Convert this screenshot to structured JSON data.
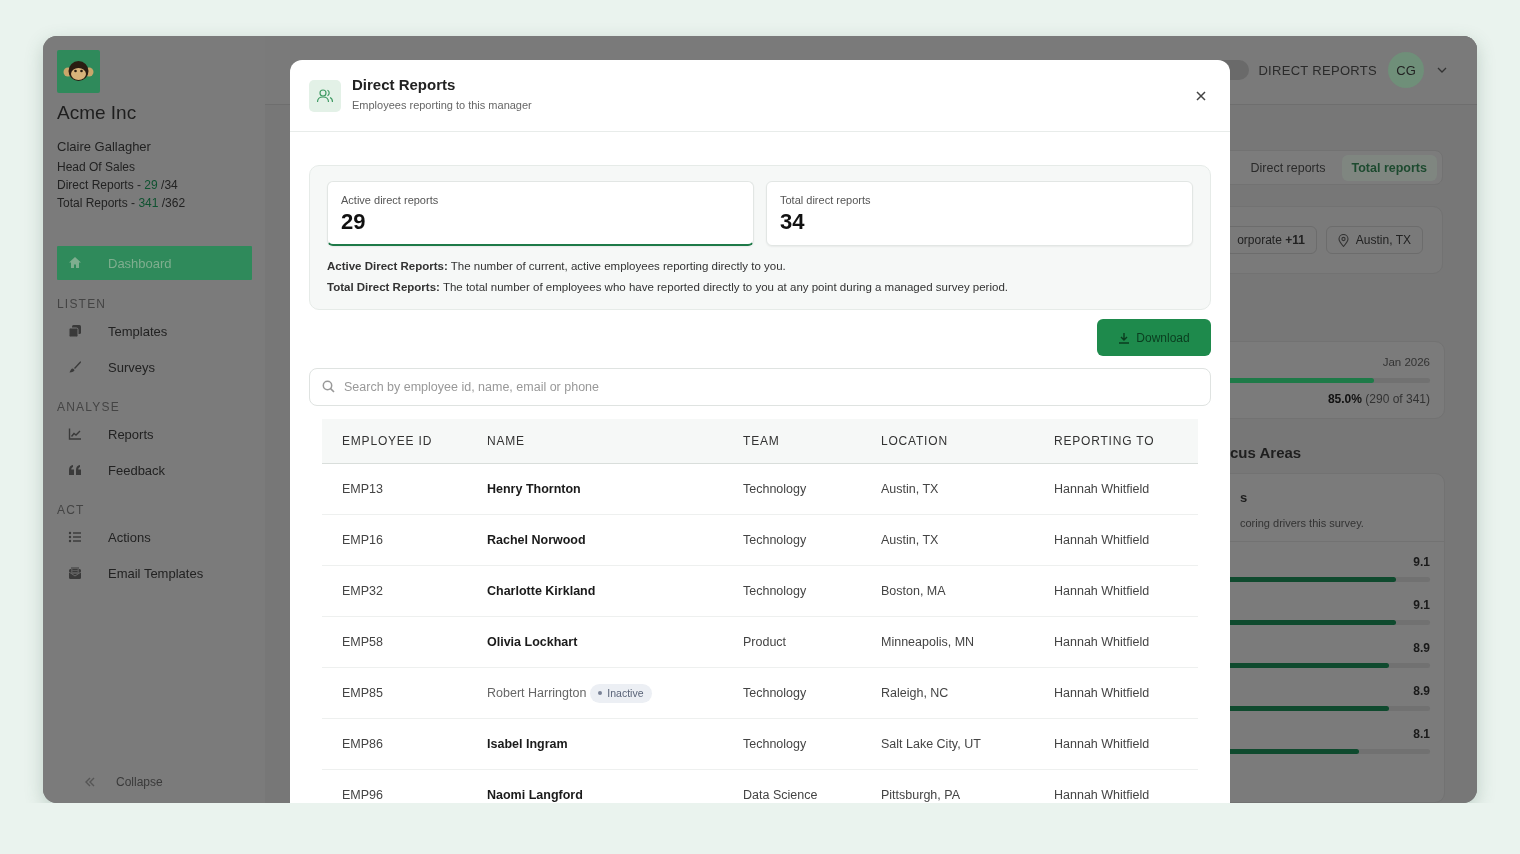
{
  "sidebar": {
    "company": "Acme Inc",
    "user": {
      "name": "Claire Gallagher",
      "role": "Head Of Sales"
    },
    "counts": [
      {
        "label": "Direct Reports -",
        "active": "29",
        "total": "/34"
      },
      {
        "label": "Total Reports -",
        "active": "341",
        "total": "/362"
      }
    ],
    "groups": [
      {
        "items": [
          {
            "label": "Dashboard",
            "selected": true
          }
        ]
      },
      {
        "heading": "LISTEN",
        "items": [
          {
            "label": "Templates",
            "selected": false
          },
          {
            "label": "Surveys",
            "selected": false
          }
        ]
      },
      {
        "heading": "ANALYSE",
        "items": [
          {
            "label": "Reports",
            "selected": false
          },
          {
            "label": "Feedback",
            "selected": false
          }
        ]
      },
      {
        "heading": "ACT",
        "items": [
          {
            "label": "Actions",
            "selected": false
          },
          {
            "label": "Email Templates",
            "selected": false
          }
        ]
      }
    ],
    "collapse": "Collapse"
  },
  "main": {
    "view_toggle_on": false,
    "view_label": "DIRECT REPORTS",
    "avatar": "CG",
    "tabs": [
      {
        "label": "Direct reports",
        "selected": false
      },
      {
        "label": "Total reports",
        "selected": true
      }
    ],
    "filters": [
      "orporate **+11**",
      "Austin, TX"
    ],
    "participation": {
      "period": "Jan 2026",
      "level": 0.85,
      "percent": "85.0%",
      "count": "(290 of 341)"
    },
    "focus_heading": "cus Areas",
    "focus_card": {
      "title": "s",
      "subtitle": "coring drivers this survey.",
      "drivers": [
        {
          "score": "9.1",
          "level": 0.91
        },
        {
          "score": "9.1",
          "level": 0.91
        },
        {
          "score": "8.9",
          "level": 0.89
        },
        {
          "score": "8.9",
          "level": 0.89
        },
        {
          "score": "8.1",
          "level": 0.81
        }
      ]
    }
  },
  "dialog": {
    "title": "Direct Reports",
    "subtitle": "Employees reporting to this manager",
    "stats": [
      {
        "label": "Active direct reports",
        "value": "29",
        "selected": true
      },
      {
        "label": "Total direct reports",
        "value": "34",
        "selected": false
      }
    ],
    "notes": [
      "**Active Direct Reports:** The number of current, active employees reporting directly to you.",
      "**Total Direct Reports:** The total number of employees who have reported directly to you at any point during a managed survey period."
    ],
    "download": {
      "label": "Download",
      "disabled": true
    },
    "search": {
      "placeholder": "Search by employee id, name, email or phone"
    },
    "table": {
      "columns": [
        "EMPLOYEE ID",
        "NAME",
        "TEAM",
        "LOCATION",
        "REPORTING TO"
      ],
      "rows": [
        {
          "id": "EMP13",
          "name": "Henry Thornton",
          "active": true,
          "team": "Technology",
          "location": "Austin, TX",
          "reporting_to": "Hannah Whitfield"
        },
        {
          "id": "EMP16",
          "name": "Rachel Norwood",
          "active": true,
          "team": "Technology",
          "location": "Austin, TX",
          "reporting_to": "Hannah Whitfield"
        },
        {
          "id": "EMP32",
          "name": "Charlotte Kirkland",
          "active": true,
          "team": "Technology",
          "location": "Boston, MA",
          "reporting_to": "Hannah Whitfield"
        },
        {
          "id": "EMP58",
          "name": "Olivia Lockhart",
          "active": true,
          "team": "Product",
          "location": "Minneapolis, MN",
          "reporting_to": "Hannah Whitfield"
        },
        {
          "id": "EMP85",
          "name": "Robert Harrington",
          "active": false,
          "badge": "Inactive",
          "team": "Technology",
          "location": "Raleigh, NC",
          "reporting_to": "Hannah Whitfield"
        },
        {
          "id": "EMP86",
          "name": "Isabel Ingram",
          "active": true,
          "team": "Technology",
          "location": "Salt Lake City, UT",
          "reporting_to": "Hannah Whitfield"
        },
        {
          "id": "EMP96",
          "name": "Naomi Langford",
          "active": true,
          "team": "Data Science",
          "location": "Pittsburgh, PA",
          "reporting_to": "Hannah Whitfield"
        }
      ]
    }
  }
}
